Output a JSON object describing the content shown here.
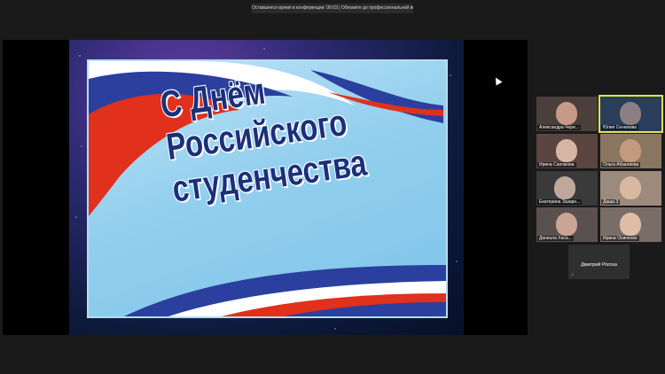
{
  "banner": {
    "text": "Оставшееся время в конференции: 00:03 | Обновите до профессиональной версии"
  },
  "slide": {
    "lines": [
      "С Днём",
      "Российского",
      "студенчества"
    ]
  },
  "participants": [
    {
      "name": "Александра Чере..."
    },
    {
      "name": "Юлия Сенюкова"
    },
    {
      "name": "Ирина Сапожова"
    },
    {
      "name": "Ольга Абзалиева"
    },
    {
      "name": "Екатерина Зазарн..."
    },
    {
      "name": "Даша З"
    },
    {
      "name": "Даниэла Хаса..."
    },
    {
      "name": "Ирина Осипенко"
    }
  ],
  "speaker": {
    "name": "Дмитрий Рогоза"
  }
}
